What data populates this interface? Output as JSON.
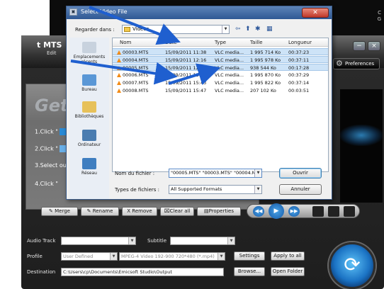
{
  "background": {
    "side_text_1": "C",
    "side_text_2": "G"
  },
  "app": {
    "title": "t MTS",
    "subtitle": "Edit",
    "minimize": "−",
    "close": "×",
    "preferences": "Preferences",
    "heading": "Getti",
    "steps": [
      "1.Click \"",
      "2.Click \"",
      "3.Select out",
      "4.Click \""
    ],
    "buttons": {
      "merge": "Merge",
      "rename": "Rename",
      "remove": "X Remove",
      "clear_all": "Clear all",
      "properties": "Properties"
    },
    "labels": {
      "audio_track": "Audio Track",
      "subtitle": "Subtitle",
      "profile": "Profile",
      "destination": "Destination"
    },
    "profile_value": "User Defined",
    "format_value": "MPEG-4 Video 192-900 720*480 (*.mp4)",
    "destination_value": "C:\\Users\\cp\\Documents\\Emicsoft Studio\\Output",
    "settings": "Settings",
    "apply_to_all": "Apply to all",
    "browse": "Browse...",
    "open_folder": "Open Folder"
  },
  "dialog": {
    "title": "Select Video File",
    "look_in_label": "Regarder dans :",
    "look_in_value": "Videos",
    "columns": [
      "Nom",
      "Date",
      "Type",
      "Taille",
      "Longueur"
    ],
    "files": [
      {
        "name": "00003.MTS",
        "date": "15/09/2011 11:38",
        "type": "VLC media...",
        "size": "1 995 714 Ko",
        "length": "00:37:23",
        "selected": true
      },
      {
        "name": "00004.MTS",
        "date": "15/09/2011 12:16",
        "type": "VLC media...",
        "size": "1 995 978 Ko",
        "length": "00:37:11",
        "selected": true
      },
      {
        "name": "00005.MTS",
        "date": "15/09/2011 12:33",
        "type": "VLC media...",
        "size": "938 544 Ko",
        "length": "00:17:28",
        "selected": true
      },
      {
        "name": "00006.MTS",
        "date": "15/09/2011 15:06",
        "type": "VLC media...",
        "size": "1 995 870 Ko",
        "length": "00:37:29",
        "selected": false
      },
      {
        "name": "00007.MTS",
        "date": "15/09/2011 15:43",
        "type": "VLC media...",
        "size": "1 995 822 Ko",
        "length": "00:37:14",
        "selected": false
      },
      {
        "name": "00008.MTS",
        "date": "15/09/2011 15:47",
        "type": "VLC media...",
        "size": "207 102 Ko",
        "length": "00:03:51",
        "selected": false
      }
    ],
    "places": [
      "Emplacements récents",
      "Bureau",
      "Bibliothèques",
      "Ordinateur",
      "Réseau"
    ],
    "filename_label": "Nom du fichier :",
    "filename_value": "\"00005.MTS\" \"00003.MTS\" \"00004.M",
    "filetype_label": "Types de fichiers :",
    "filetype_value": "All Supported Formats",
    "open": "Ouvrir",
    "cancel": "Annuler"
  },
  "colors": {
    "accent": "#1f6fd1",
    "selection": "#cde3f7",
    "arrow": "#1f5fcf"
  }
}
